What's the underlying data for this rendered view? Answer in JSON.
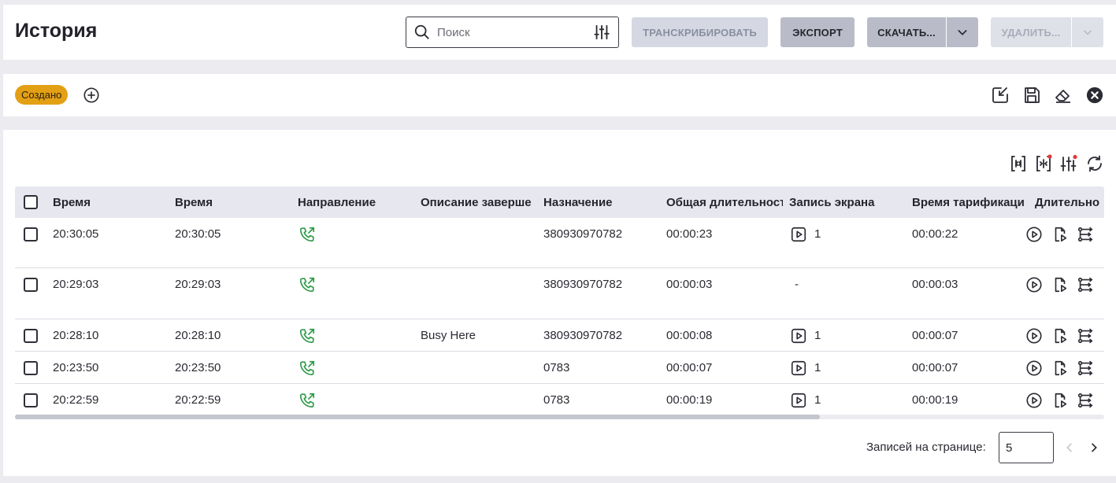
{
  "header": {
    "title": "История",
    "search": {
      "placeholder": "Поиск",
      "value": ""
    },
    "buttons": {
      "transcribe": "ТРАНСКРИБИРОВАТЬ",
      "export": "ЭКСПОРТ",
      "download": "СКАЧАТЬ...",
      "delete": "УДАЛИТЬ..."
    }
  },
  "filters": {
    "chips": [
      {
        "label": "Создано"
      }
    ]
  },
  "table": {
    "columns": [
      "Время",
      "Время",
      "Направление",
      "Описание заверше",
      "Назначение",
      "Общая длительност",
      "Запись экрана",
      "Время тарификаци",
      "Длительно"
    ],
    "rows": [
      {
        "time1": "20:30:05",
        "time2": "20:30:05",
        "description": "",
        "destination": "380930970782",
        "total_duration": "00:00:23",
        "screen_record": "1",
        "has_record": true,
        "billing_time": "00:00:22"
      },
      {
        "time1": "20:29:03",
        "time2": "20:29:03",
        "description": "",
        "destination": "380930970782",
        "total_duration": "00:00:03",
        "screen_record": "-",
        "has_record": false,
        "billing_time": "00:00:03"
      },
      {
        "time1": "20:28:10",
        "time2": "20:28:10",
        "description": "Busy Here",
        "destination": "380930970782",
        "total_duration": "00:00:08",
        "screen_record": "1",
        "has_record": true,
        "billing_time": "00:00:07"
      },
      {
        "time1": "20:23:50",
        "time2": "20:23:50",
        "description": "",
        "destination": "0783",
        "total_duration": "00:00:07",
        "screen_record": "1",
        "has_record": true,
        "billing_time": "00:00:07"
      },
      {
        "time1": "20:22:59",
        "time2": "20:22:59",
        "description": "",
        "destination": "0783",
        "total_duration": "00:00:19",
        "screen_record": "1",
        "has_record": true,
        "billing_time": "00:00:19"
      }
    ]
  },
  "pagination": {
    "label": "Записей на странице:",
    "per_page": "5"
  },
  "colors": {
    "accent_chip": "#e3a014",
    "call_icon": "#2e9b48",
    "badge_dot": "#e03a3a"
  }
}
